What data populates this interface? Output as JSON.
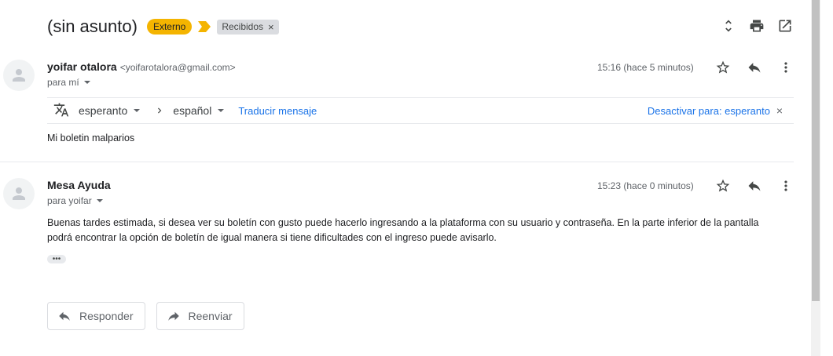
{
  "thread": {
    "subject": "(sin asunto)",
    "badge": "Externo",
    "label": "Recibidos",
    "label_close": "×"
  },
  "messages": [
    {
      "sender_name": "yoifar otalora",
      "sender_email": "<yoifarotalora@gmail.com>",
      "to": "para mí",
      "time": "15:16 (hace 5 minutos)",
      "body": "Mi boletin malparios"
    },
    {
      "sender_name": "Mesa Ayuda",
      "to": "para yoifar",
      "time": "15:23 (hace 0 minutos)",
      "body_line1": "Buenas tardes estimada, si desea ver su boletín con gusto puede hacerlo ingresando a la plataforma con su usuario y contraseña. En la parte inferior de la pantalla",
      "body_line2": "podrá encontrar la opción de boletín de igual manera si tiene dificultades con el ingreso puede avisarlo.",
      "ellipsis": "•••"
    }
  ],
  "translate": {
    "source_lang": "esperanto",
    "target_lang": "español",
    "translate_link": "Traducir mensaje",
    "disable_link": "Desactivar para: esperanto",
    "close": "×"
  },
  "actions": {
    "reply": "Responder",
    "forward": "Reenviar"
  },
  "colors": {
    "badge_bg": "#f4b400",
    "link": "#1a73e8",
    "label_bg": "#dadce0"
  },
  "icons": {
    "expand": "unfold-icon",
    "print": "print-icon",
    "open_new": "open-in-new-icon",
    "star": "star-icon",
    "reply": "reply-icon",
    "more": "more-vert-icon",
    "translate": "translate-icon",
    "forward": "forward-icon",
    "avatar": "person-icon"
  }
}
